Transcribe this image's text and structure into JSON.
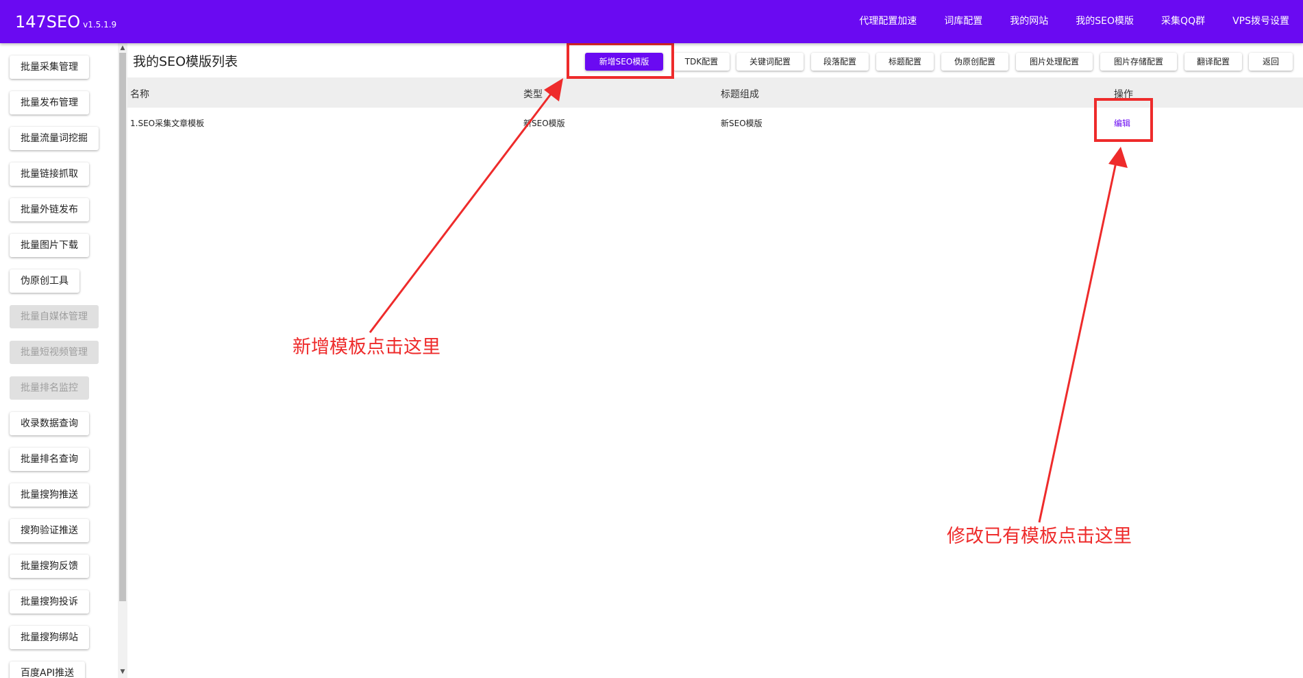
{
  "header": {
    "brand": "147SEO",
    "version": "v1.5.1.9",
    "nav": [
      "代理配置加速",
      "词库配置",
      "我的网站",
      "我的SEO模版",
      "采集QQ群",
      "VPS拨号设置"
    ],
    "bg_color": "#6a0af2"
  },
  "sidebar": {
    "items": [
      {
        "label": "批量采集管理",
        "disabled": false
      },
      {
        "label": "批量发布管理",
        "disabled": false
      },
      {
        "label": "批量流量词挖掘",
        "disabled": false
      },
      {
        "label": "批量链接抓取",
        "disabled": false
      },
      {
        "label": "批量外链发布",
        "disabled": false
      },
      {
        "label": "批量图片下载",
        "disabled": false
      },
      {
        "label": "伪原创工具",
        "disabled": false
      },
      {
        "label": "批量自媒体管理",
        "disabled": true
      },
      {
        "label": "批量短视频管理",
        "disabled": true
      },
      {
        "label": "批量排名监控",
        "disabled": true
      },
      {
        "label": "收录数据查询",
        "disabled": false
      },
      {
        "label": "批量排名查询",
        "disabled": false
      },
      {
        "label": "批量搜狗推送",
        "disabled": false
      },
      {
        "label": "搜狗验证推送",
        "disabled": false
      },
      {
        "label": "批量搜狗反馈",
        "disabled": false
      },
      {
        "label": "批量搜狗投诉",
        "disabled": false
      },
      {
        "label": "批量搜狗绑站",
        "disabled": false
      },
      {
        "label": "百度API推送",
        "disabled": false
      }
    ]
  },
  "main": {
    "title": "我的SEO模版列表",
    "toolbar": [
      "新增SEO模版",
      "TDK配置",
      "关键词配置",
      "段落配置",
      "标题配置",
      "伪原创配置",
      "图片处理配置",
      "图片存储配置",
      "翻译配置",
      "返回"
    ],
    "table": {
      "columns": [
        "名称",
        "类型",
        "标题组成",
        "操作"
      ],
      "rows": [
        {
          "name": "1.SEO采集文章模板",
          "type": "新SEO模版",
          "title_comp": "新SEO模版",
          "action": "编辑"
        }
      ]
    }
  },
  "annotations": {
    "add_hint": "新增模板点击这里",
    "edit_hint": "修改已有模板点击这里",
    "color": "#ee2b2b"
  }
}
